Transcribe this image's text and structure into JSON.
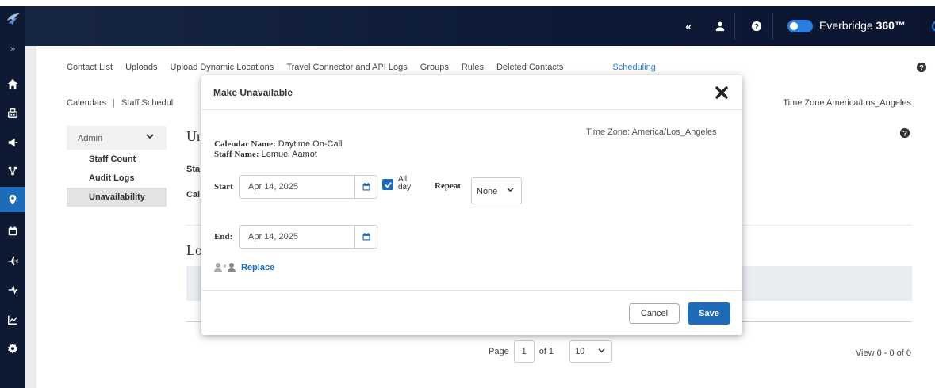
{
  "topnav": {
    "collapse_icon": "double-chevron-left",
    "user_icon": "user",
    "help_icon": "question-circle",
    "brand_prefix": "Everbridge",
    "brand_suffix": "360™",
    "power_icon": "power"
  },
  "rail": {
    "expand_label": "»",
    "items": [
      "home",
      "org",
      "megaphone",
      "network",
      "location-pin",
      "calendar",
      "plane",
      "incident",
      "chart",
      "gear"
    ],
    "active": "location-pin"
  },
  "tabs": [
    "Contact List",
    "Uploads",
    "Upload Dynamic Locations",
    "Travel Connector and API Logs",
    "Groups",
    "Rules",
    "Deleted Contacts",
    "Scheduling"
  ],
  "active_tab": "Scheduling",
  "sub_tabs": {
    "first": "Calendars",
    "sep": "|",
    "second": "Staff Schedul"
  },
  "timezone_right": "Time Zone America/Los_Angeles",
  "sidebar": {
    "header": "Admin",
    "items": [
      "Staff Count",
      "Audit Logs",
      "Unavailability"
    ],
    "selected": "Unavailability"
  },
  "main": {
    "title_fragment": "Ur",
    "st_fragment": "Sta",
    "cal_fragment": "Cal",
    "lo_fragment": "Lo"
  },
  "pager": {
    "page_label": "Page",
    "page": "1",
    "of_label": "of 1",
    "page_size": "10",
    "view_count": "View 0 - 0 of 0"
  },
  "modal": {
    "title": "Make Unavailable",
    "timezone": "Time Zone: America/Los_Angeles",
    "calendar_label": "Calendar Name:",
    "calendar_value": "Daytime On-Call",
    "staff_label": "Staff Name:",
    "staff_value": "Lemuel Aamot",
    "start_label": "Start",
    "start_value": "Apr 14, 2025",
    "allday_label": "All day",
    "allday_checked": true,
    "repeat_label": "Repeat",
    "repeat_value": "None",
    "end_label": "End:",
    "end_value": "Apr 14, 2025",
    "replace_label": "Replace",
    "cancel_label": "Cancel",
    "save_label": "Save"
  },
  "colors": {
    "accent": "#1e6bb8",
    "nav_bg": "#0e1a33",
    "link": "#2a7de1"
  }
}
